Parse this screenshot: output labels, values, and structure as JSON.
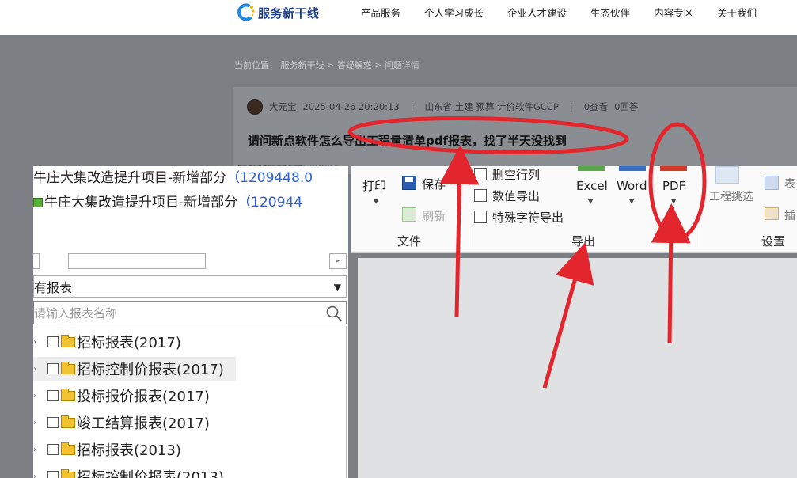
{
  "nav": {
    "logo_text": "服务新干线",
    "items": [
      "产品服务",
      "个人学习成长",
      "企业人才建设",
      "生态伙伴",
      "内容专区",
      "关于我们"
    ]
  },
  "breadcrumb": "当前位置： 服务新干线 > 答疑解惑 > 问题详情",
  "post": {
    "author": "大元宝",
    "datetime": "2025-04-26 20:20:13",
    "sep1": "|",
    "location": "山东省 土建 预算 计价软件GCCP",
    "sep2": "|",
    "views": "0查看",
    "answers": "0回答",
    "title": "请问新点软件怎么导出工程量清单pdf报表，找了半天没找到",
    "tiny_text": "牛庄 工程改造提升项目-新增部分（1209448.0"
  },
  "left_panel": {
    "project_line1": "牛庄大集改造提升项目-新增部分",
    "project_line1_num": "（1209448.0",
    "project_line2": "牛庄大集改造提升项目-新增部分",
    "project_line2_num": "（120944",
    "scroll_right": "▸",
    "report_filter": "有报表",
    "search_placeholder": "请输入报表名称",
    "tree": [
      {
        "label": "招标报表(2017)",
        "highlighted": false
      },
      {
        "label": "招标控制价报表(2017)",
        "highlighted": true
      },
      {
        "label": "投标报价报表(2017)",
        "highlighted": false
      },
      {
        "label": "竣工结算报表(2017)",
        "highlighted": false
      },
      {
        "label": "招标报表(2013)",
        "highlighted": false
      },
      {
        "label": "招标控制价报表(2013)",
        "highlighted": false
      }
    ]
  },
  "ribbon": {
    "print": "打印",
    "save": "保存",
    "refresh": "刷新",
    "group_file": "文件",
    "delete_empty_rows": "删空行列",
    "numeric_export": "数值导出",
    "special_char_export": "特殊字符导出",
    "excel": "Excel",
    "word": "Word",
    "pdf": "PDF",
    "group_export": "导出",
    "project_filter": "工程挑选",
    "table_partial": "表",
    "insert_partial": "插",
    "group_settings": "设置"
  },
  "colors": {
    "annotation_red": "#e3262d",
    "dim_overlay": "#7b7f83",
    "link_blue": "#2f5fd0"
  }
}
